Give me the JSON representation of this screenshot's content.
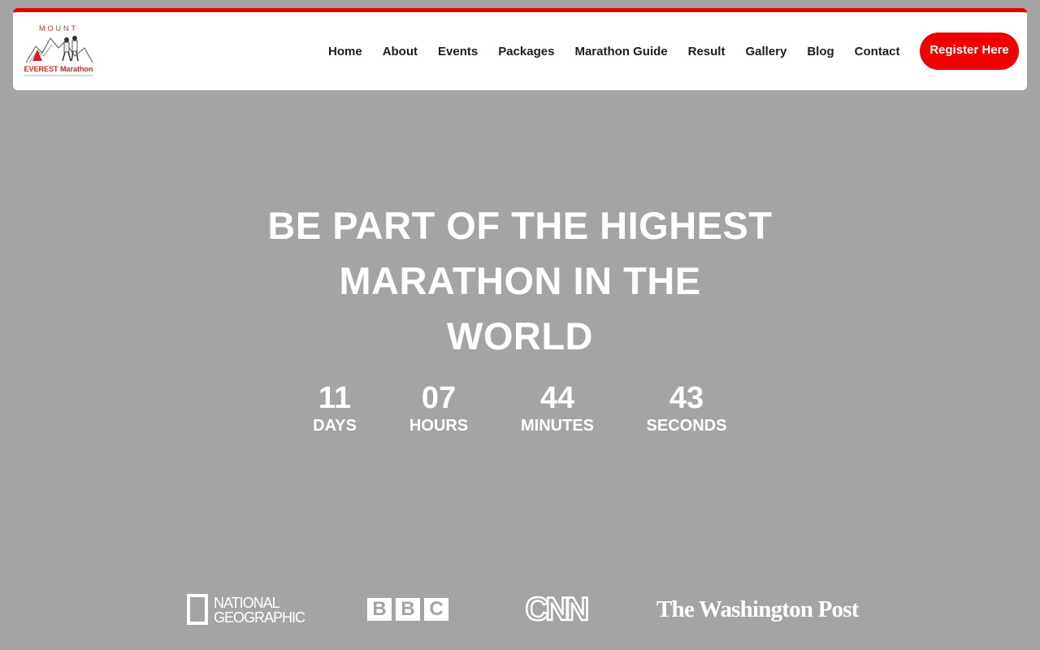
{
  "header": {
    "accent_color": "#e10600",
    "logo": {
      "top_text": "MOUNT",
      "main_text": "EVEREST Marathon",
      "icon": "everest-marathon-logo"
    },
    "nav": [
      {
        "label": "Home"
      },
      {
        "label": "About"
      },
      {
        "label": "Events"
      },
      {
        "label": "Packages"
      },
      {
        "label": "Marathon Guide"
      },
      {
        "label": "Result"
      },
      {
        "label": "Gallery"
      },
      {
        "label": "Blog"
      },
      {
        "label": "Contact"
      }
    ],
    "register_label": "Register Here",
    "register_color": "#f00000"
  },
  "hero": {
    "title_lines": [
      "BE PART OF THE HIGHEST",
      "MARATHON IN THE",
      "WORLD"
    ],
    "countdown": {
      "days": "11",
      "days_label": "DAYS",
      "hours": "07",
      "hours_label": "HOURS",
      "minutes": "44",
      "minutes_label": "MINUTES",
      "seconds": "43",
      "seconds_label": "SECONDS"
    }
  },
  "partners": {
    "natgeo_line1": "NATIONAL",
    "natgeo_line2": "GEOGRAPHIC",
    "bbc": [
      "B",
      "B",
      "C"
    ],
    "cnn": "CNN",
    "wapo": "The Washington Post"
  }
}
